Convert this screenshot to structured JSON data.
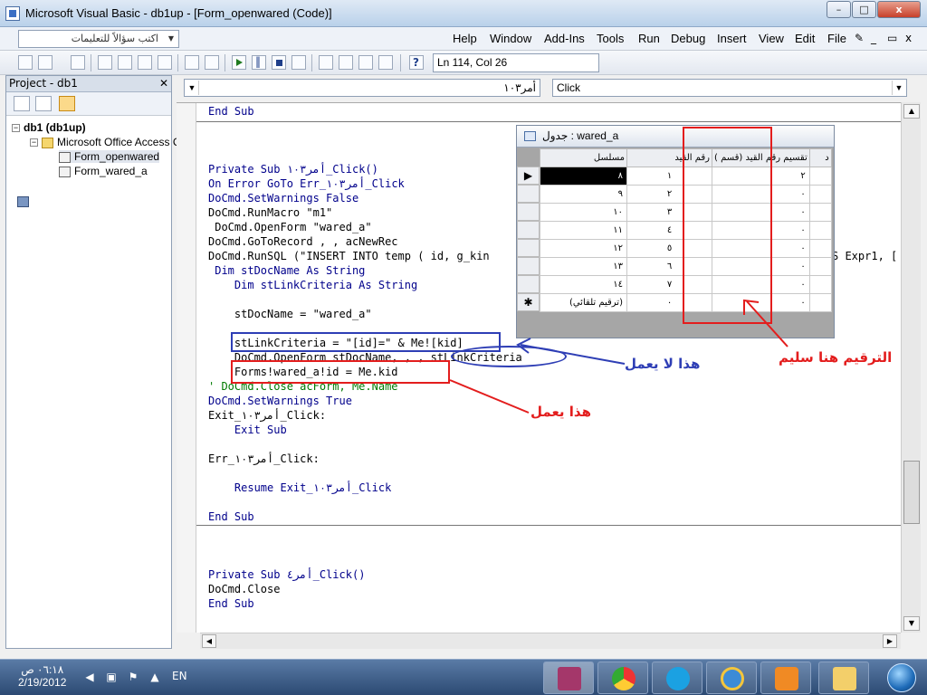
{
  "window": {
    "title": "Microsoft Visual Basic - db1up - [Form_openwared (Code)]",
    "controls": {
      "min": "–",
      "max": "□",
      "close": "x"
    }
  },
  "menubar": {
    "ask_box": "اكتب سؤالاً للتعليمات",
    "items": [
      "Help",
      "Window",
      "Add-Ins",
      "Tools",
      "Run",
      "Debug",
      "Insert",
      "View",
      "Edit",
      "File"
    ],
    "mdi_controls": {
      "min": "_",
      "restore": "▭",
      "close": "x"
    }
  },
  "toolbar": {
    "position": "Ln 114, Col 26"
  },
  "project": {
    "title": "Project - db1",
    "tree": [
      {
        "label": "db1 (db1up)",
        "level": 0,
        "icon": "project-icon"
      },
      {
        "label": "Microsoft Office Access C",
        "level": 1,
        "icon": "folder-icon"
      },
      {
        "label": "Form_openwared",
        "level": 2,
        "icon": "form-icon"
      },
      {
        "label": "Form_wared_a",
        "level": 2,
        "icon": "form-icon"
      }
    ]
  },
  "code": {
    "object_combo": "أمر١٠٣",
    "proc_combo": "Click",
    "lines": [
      "End Sub",
      "Private Sub أمر١٠٣_Click()",
      "On Error GoTo Err_أمر١٠٣_Click",
      "DoCmd.SetWarnings False",
      "DoCmd.RunMacro \"m1\"",
      " DoCmd.OpenForm \"wared_a\"",
      "DoCmd.GoToRecord , , acNewRec",
      "DoCmd.RunSQL (\"INSERT INTO temp ( id, g_kin",
      " Dim stDocName As String",
      "    Dim stLinkCriteria As String",
      "    stDocName = \"wared_a\"",
      "    stLinkCriteria = \"[id]=\" & Me![kid]",
      "    DoCmd.OpenForm stDocName, , , stLinkCriteria",
      "    Forms!wared_a!id = Me.kid",
      "' DoCmd.Close acForm, Me.Name",
      "DoCmd.SetWarnings True",
      "Exit_أمر١٠٣_Click:",
      "    Exit Sub",
      "Err_أمر١٠٣_Click:",
      "    Resume Exit_أمر١٠٣_Click",
      "End Sub",
      "Private Sub أمر٤_Click()",
      "DoCmd.Close",
      "End Sub"
    ],
    "truncated_right": "S Expr1, ["
  },
  "table_window": {
    "title": "جدول : wared_a",
    "columns": [
      "مسلسل",
      "رقم القيد",
      "تقسيم رقم القيد (قسم )",
      "د"
    ],
    "rows": [
      [
        "٨",
        "١",
        "٢"
      ],
      [
        "٩",
        "٢",
        "٠"
      ],
      [
        "١٠",
        "٣",
        "٠"
      ],
      [
        "١١",
        "٤",
        "٠"
      ],
      [
        "١٢",
        "٥",
        "٠"
      ],
      [
        "١٣",
        "٦",
        "٠"
      ],
      [
        "١٤",
        "٧",
        "٠"
      ],
      [
        "(ترقيم تلقائي)",
        "٠",
        "٠"
      ]
    ],
    "row_markers": [
      "▶",
      "",
      "",
      "",
      "",
      "",
      "",
      "✱"
    ]
  },
  "annotations": {
    "numbering_ok": "الترقيم هنا سليم",
    "not_working": "هذا لا يعمل",
    "working": "هذا يعمل"
  },
  "taskbar": {
    "time": "٠٦:١٨ ص",
    "date": "2/19/2012",
    "lang": "EN"
  },
  "colors": {
    "keyword": "#00008b",
    "comment": "#007a00",
    "annotation_red": "#e31d1d",
    "annotation_blue": "#2e3eb5"
  }
}
